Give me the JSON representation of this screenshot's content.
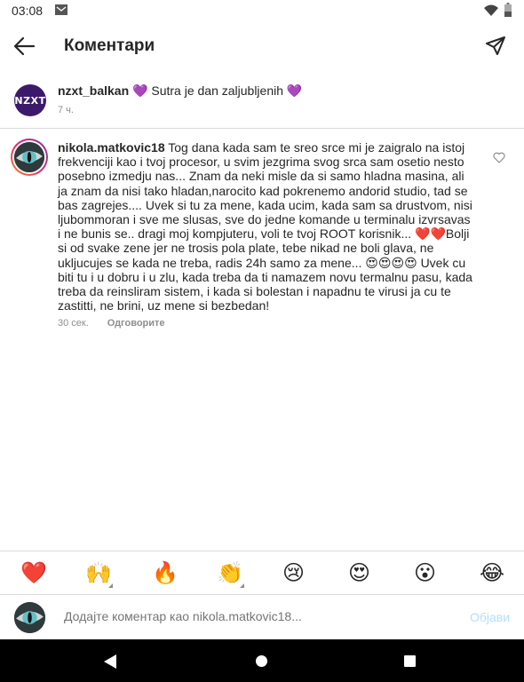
{
  "status_bar": {
    "time": "03:08",
    "icons": [
      "mail-icon",
      "wifi-icon",
      "battery-icon"
    ]
  },
  "header": {
    "title": "Коментари",
    "back_icon": "arrow-left-icon",
    "send_icon": "paper-plane-icon"
  },
  "caption": {
    "username": "nzxt_balkan",
    "avatar_text": "NZXT",
    "text": "Sutra je dan zaljubljenih",
    "emoji": "💜",
    "time": "7 ч."
  },
  "comment": {
    "username": "nikola.matkovic18",
    "text": "Tog dana  kada sam te sreo  srce mi je zaigralo na istoj frekvenciji kao i tvoj procesor, u svim jezgrima svog srca sam osetio nesto posebno izmedju nas...  Znam da neki misle da si samo hladna masina, ali ja znam da nisi tako hladan,narocito kad pokrenemo andorid studio, tad se bas zagrejes....  Uvek si tu za mene, kada ucim, kada sam sa drustvom, nisi ljubommoran  i sve me slusas, sve do jedne komande u terminalu izvrsavas i ne bunis se.. dragi moj kompjuteru, voli te tvoj ROOT korisnik... ❤️❤️Bolji si od svake zene jer ne trosis pola plate, tebe nikad ne boli glava, ne ukljucujes se kada ne treba, radis 24h  samo za mene... 😍😍😍😍 Uvek cu biti tu i u dobru i u zlu, kada treba da ti namazem novu termalnu pasu, kada treba da reinsliram sistem, i kada si bolestan i napadnu te virusi ja cu te zastitti,  ne brini, uz mene si bezbedan!",
    "time": "30 сек.",
    "reply_label": "Одговорите",
    "like_icon": "heart-outline-icon"
  },
  "emoji_bar": [
    "❤️",
    "🙌",
    "🔥",
    "👏",
    "😢",
    "😍",
    "😮",
    "😂"
  ],
  "composer": {
    "placeholder": "Додајте коментар као nikola.matkovic18...",
    "post_label": "Објави"
  },
  "nav": {
    "icons": [
      "nav-back-icon",
      "nav-home-icon",
      "nav-recents-icon"
    ]
  },
  "colors": {
    "accent_disabled": "#b2dffc",
    "secondary_text": "#8e8e8e",
    "divider": "#dbdbdb"
  }
}
